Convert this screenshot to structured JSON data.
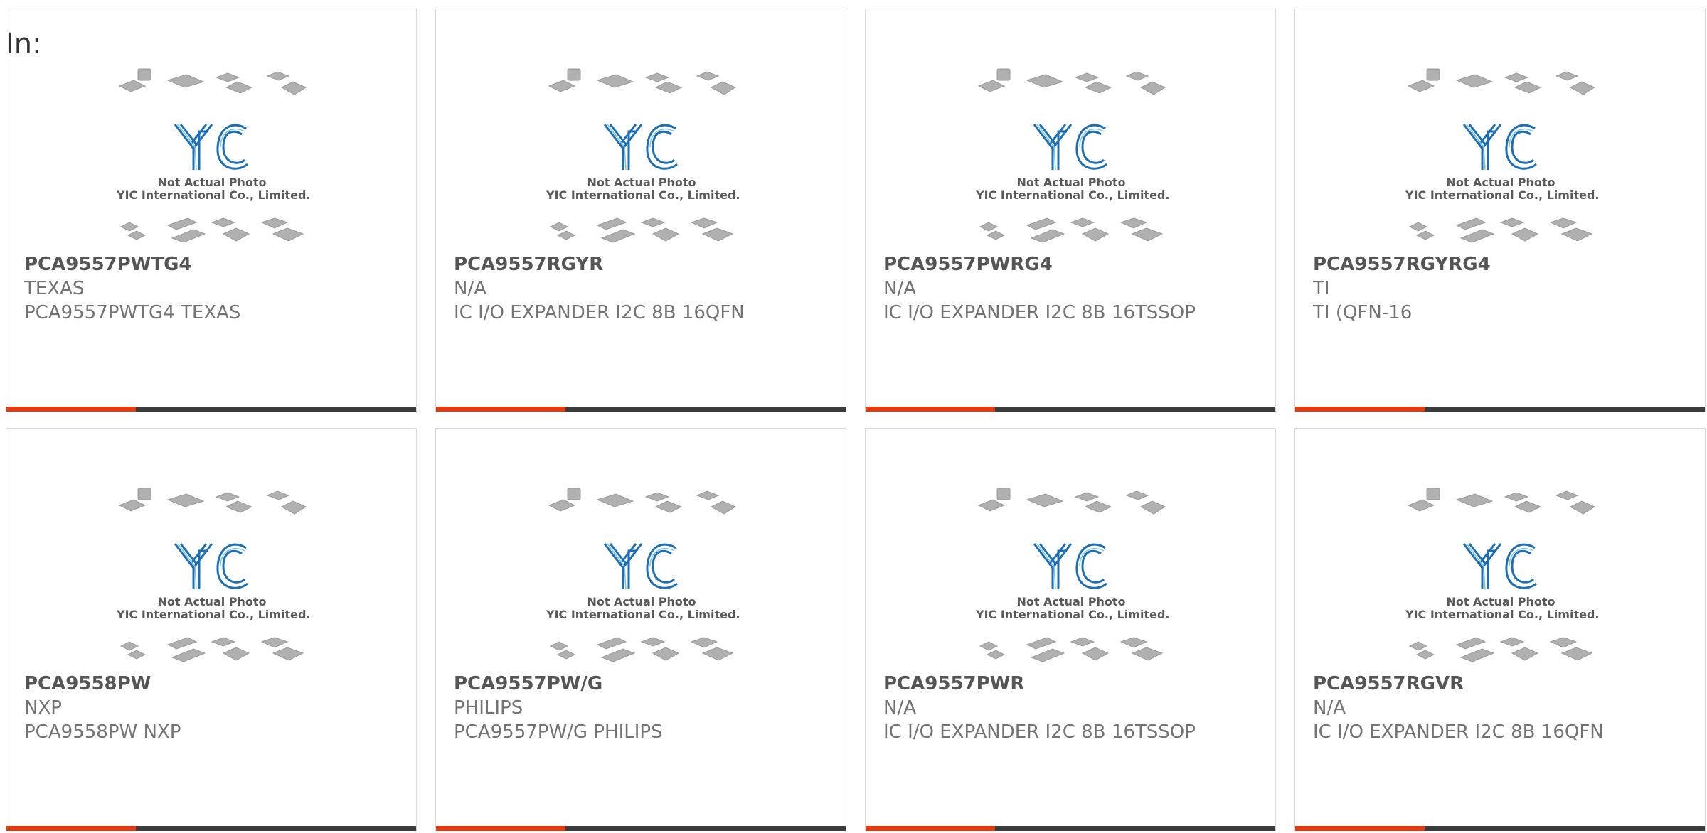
{
  "header": {
    "label": "In:"
  },
  "brand": {
    "accent": "#e8380d",
    "dark": "#3b3b3b",
    "logo_blue": "#1c6fb5"
  },
  "thumbnail": {
    "logo_text": "YIC",
    "caption_line1": "Not Actual Photo",
    "caption_line2": "YIC International Co., Limited."
  },
  "products": [
    {
      "part": "PCA9557PWTG4",
      "manufacturer": "TEXAS",
      "description": "PCA9557PWTG4 TEXAS"
    },
    {
      "part": "PCA9557RGYR",
      "manufacturer": "N/A",
      "description": "IC I/O EXPANDER I2C 8B 16QFN"
    },
    {
      "part": "PCA9557PWRG4",
      "manufacturer": "N/A",
      "description": "IC I/O EXPANDER I2C 8B 16TSSOP"
    },
    {
      "part": "PCA9557RGYRG4",
      "manufacturer": "TI",
      "description": "TI (QFN-16"
    },
    {
      "part": "PCA9558PW",
      "manufacturer": "NXP",
      "description": "PCA9558PW NXP"
    },
    {
      "part": "PCA9557PW/G",
      "manufacturer": "PHILIPS",
      "description": "PCA9557PW/G PHILIPS"
    },
    {
      "part": "PCA9557PWR",
      "manufacturer": "N/A",
      "description": "IC I/O EXPANDER I2C 8B 16TSSOP"
    },
    {
      "part": "PCA9557RGVR",
      "manufacturer": "N/A",
      "description": "IC I/O EXPANDER I2C 8B 16QFN"
    }
  ]
}
